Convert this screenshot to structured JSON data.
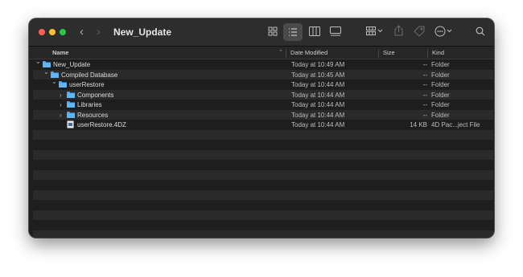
{
  "window": {
    "title": "New_Update"
  },
  "nav": {
    "back": "‹",
    "forward": "›"
  },
  "toolbar": {
    "icon_view": "grid-icon",
    "list_view": "list-icon",
    "column_view": "columns-icon",
    "gallery_view": "gallery-icon",
    "group": "group-icon",
    "share": "share-icon",
    "tag": "tag-icon",
    "more": "more-icon",
    "search": "search-icon"
  },
  "columns": {
    "name": "Name",
    "date": "Date Modified",
    "size": "Size",
    "kind": "Kind"
  },
  "rows": [
    {
      "name": "New_Update",
      "date": "Today at 10:49 AM",
      "size": "--",
      "kind": "Folder",
      "depth": 0,
      "type": "folder",
      "disclosure": "expanded"
    },
    {
      "name": "Compiled Database",
      "date": "Today at 10:45 AM",
      "size": "--",
      "kind": "Folder",
      "depth": 1,
      "type": "folder",
      "disclosure": "expanded"
    },
    {
      "name": "userRestore",
      "date": "Today at 10:44 AM",
      "size": "--",
      "kind": "Folder",
      "depth": 2,
      "type": "folder",
      "disclosure": "expanded"
    },
    {
      "name": "Components",
      "date": "Today at 10:44 AM",
      "size": "--",
      "kind": "Folder",
      "depth": 3,
      "type": "folder",
      "disclosure": "collapsed"
    },
    {
      "name": "Libraries",
      "date": "Today at 10:44 AM",
      "size": "--",
      "kind": "Folder",
      "depth": 3,
      "type": "folder",
      "disclosure": "collapsed"
    },
    {
      "name": "Resources",
      "date": "Today at 10:44 AM",
      "size": "--",
      "kind": "Folder",
      "depth": 3,
      "type": "folder",
      "disclosure": "collapsed"
    },
    {
      "name": "userRestore.4DZ",
      "date": "Today at 10:44 AM",
      "size": "14 KB",
      "kind": "4D Pac...ject File",
      "depth": 3,
      "type": "file",
      "disclosure": "none"
    }
  ],
  "colors": {
    "folder": "#4aa8f0",
    "background": "#1e1e1e",
    "toolbar": "#2d2d2d"
  }
}
